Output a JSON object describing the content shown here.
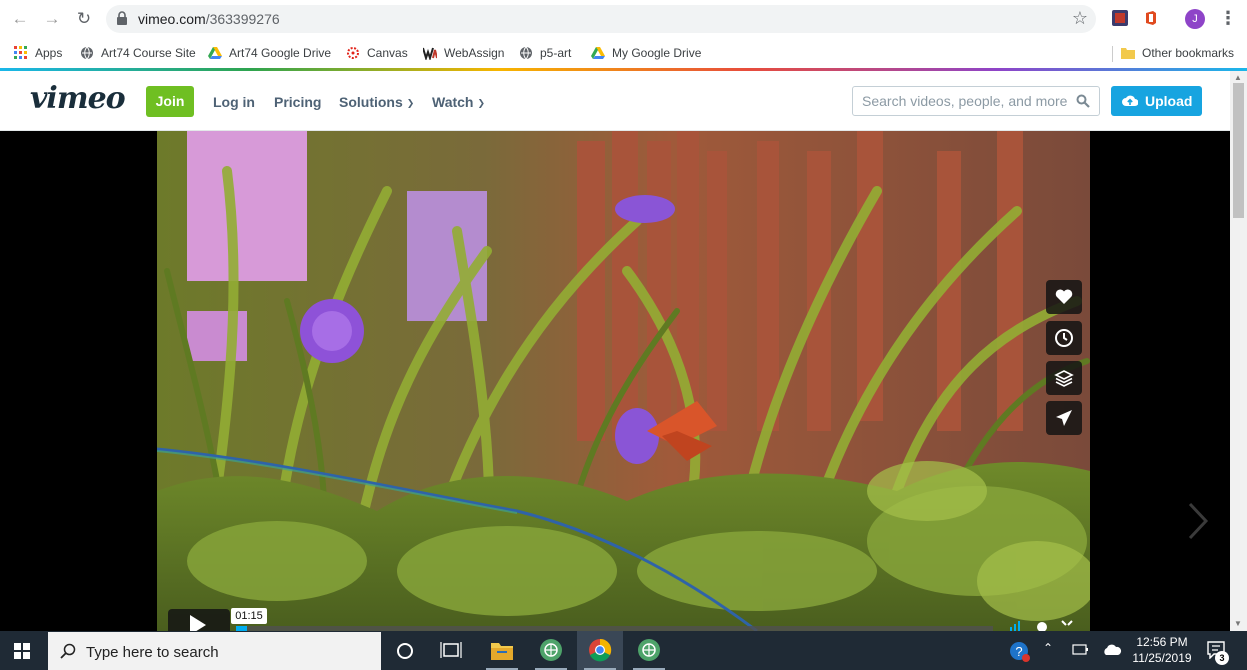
{
  "browser": {
    "url_host": "vimeo.com",
    "url_path": "/363399276",
    "profile_initial": "J"
  },
  "bookmarks": {
    "items": [
      {
        "label": "Apps",
        "icon": "apps-grid-icon"
      },
      {
        "label": "Art74 Course Site",
        "icon": "globe-icon"
      },
      {
        "label": "Art74 Google Drive",
        "icon": "google-drive-icon"
      },
      {
        "label": "Canvas",
        "icon": "canvas-icon"
      },
      {
        "label": "WebAssign",
        "icon": "webassign-icon"
      },
      {
        "label": "p5-art",
        "icon": "globe-icon"
      },
      {
        "label": "My Google Drive",
        "icon": "google-drive-icon"
      }
    ],
    "other": "Other bookmarks"
  },
  "header": {
    "logo": "vimeo",
    "join": "Join",
    "login": "Log in",
    "pricing": "Pricing",
    "solutions": "Solutions",
    "watch": "Watch",
    "search_placeholder": "Search videos, people, and more",
    "upload": "Upload"
  },
  "player": {
    "current_time": "01:15",
    "progress": 0.015,
    "side_actions": [
      "heart-icon",
      "clock-icon",
      "layers-icon",
      "send-icon"
    ]
  },
  "taskbar": {
    "search_text": "Type here to search",
    "time": "12:56 PM",
    "date": "11/25/2019",
    "notification_count": "3"
  },
  "colors": {
    "vimeo_blue": "#17a4e0",
    "join_green": "#6fbf22",
    "taskbar_bg": "#1f2a35"
  }
}
